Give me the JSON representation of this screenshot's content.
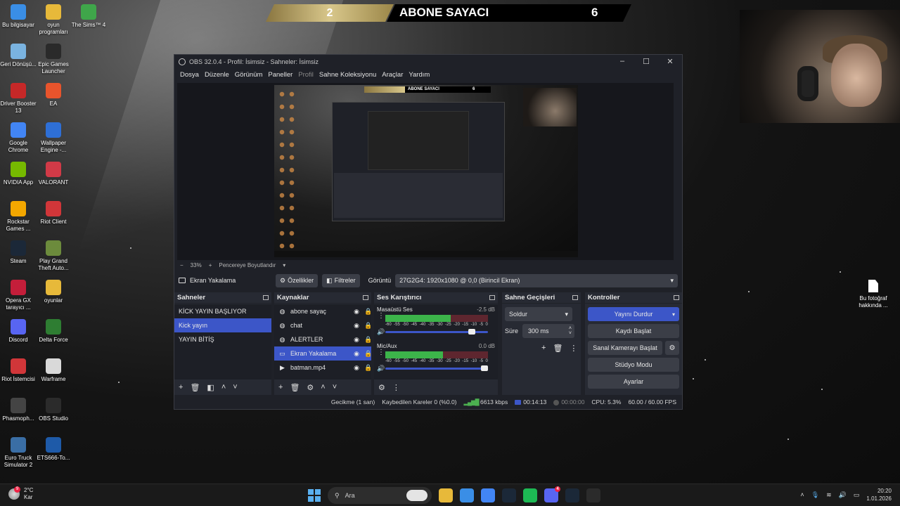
{
  "desktop": {
    "icons_left": [
      {
        "label": "Bu bilgisayar",
        "icon": "computer-icon",
        "color": "#3a8ee6"
      },
      {
        "label": "oyun programları",
        "icon": "folder-icon",
        "color": "#e7b93a"
      },
      {
        "label": "The Sims™ 4",
        "icon": "sims-icon",
        "color": "#3fa64a"
      },
      {
        "label": "Geri Dönüşü...",
        "icon": "recycle-bin-icon",
        "color": "#7ab3e0"
      },
      {
        "label": "Epic Games Launcher",
        "icon": "epic-games-icon",
        "color": "#2a2a2a"
      },
      {
        "label": "Driver Booster 13",
        "icon": "driver-booster-icon",
        "color": "#c62828"
      },
      {
        "label": "EA",
        "icon": "ea-icon",
        "color": "#e8542c"
      },
      {
        "label": "Google Chrome",
        "icon": "chrome-icon",
        "color": "#4285f4"
      },
      {
        "label": "Wallpaper Engine -...",
        "icon": "wallpaper-engine-icon",
        "color": "#2e6fd6"
      },
      {
        "label": "NVIDIA App",
        "icon": "nvidia-icon",
        "color": "#76b900"
      },
      {
        "label": "VALORANT",
        "icon": "valorant-icon",
        "color": "#d13a47"
      },
      {
        "label": "Rockstar Games ...",
        "icon": "rockstar-icon",
        "color": "#f3a700"
      },
      {
        "label": "Riot Client",
        "icon": "riot-client-icon",
        "color": "#d13639"
      },
      {
        "label": "Steam",
        "icon": "steam-icon",
        "color": "#1b2838"
      },
      {
        "label": "Play Grand Theft Auto...",
        "icon": "gta-icon",
        "color": "#6c8b3c"
      },
      {
        "label": "Opera GX tarayıcı ...",
        "icon": "opera-gx-icon",
        "color": "#c41e3a"
      },
      {
        "label": "oyunlar",
        "icon": "folder-icon",
        "color": "#e7b93a"
      },
      {
        "label": "Discord",
        "icon": "discord-icon",
        "color": "#5865f2"
      },
      {
        "label": "Delta Force",
        "icon": "delta-force-icon",
        "color": "#2e7d32"
      },
      {
        "label": "Riot İstemcisi",
        "icon": "riot-client-icon",
        "color": "#d13639"
      },
      {
        "label": "Warframe",
        "icon": "warframe-icon",
        "color": "#d9d9d9"
      },
      {
        "label": "Phasmoph...",
        "icon": "phasmophobia-icon",
        "color": "#444444"
      },
      {
        "label": "OBS Studio",
        "icon": "obs-icon",
        "color": "#2b2b2b"
      },
      {
        "label": "Euro Truck Simulator 2",
        "icon": "ets2-icon",
        "color": "#3a6ea5"
      },
      {
        "label": "ETS666-To...",
        "icon": "ets-icon",
        "color": "#1e5aa8"
      }
    ],
    "file_right": "Bu fotoğraf hakkında ..."
  },
  "counter": {
    "left_value": "2",
    "title": "ABONE SAYACI",
    "right_value": "6"
  },
  "obs": {
    "title": "OBS 32.0.4 - Profil: İsimsiz - Sahneler: İsimsiz",
    "menu": [
      "Dosya",
      "Düzenle",
      "Görünüm",
      "Paneller",
      "Profil",
      "Sahne Koleksiyonu",
      "Araçlar",
      "Yardım"
    ],
    "zoom": {
      "minus": "−",
      "value": "33%",
      "plus": "+",
      "fit": "Pencereye Boyutlandır"
    },
    "context": {
      "source": "Ekran Yakalama",
      "properties": "Özellikler",
      "filters": "Filtreler",
      "display_label": "Görüntü",
      "display_value": "27G2G4: 1920x1080 @ 0,0 (Birincil Ekran)"
    },
    "scenes": {
      "title": "Sahneler",
      "items": [
        "KİCK YAYIN BAŞLIYOR",
        "Kick yayın",
        "YAYIN BİTİŞ"
      ],
      "selected_index": 1
    },
    "sources": {
      "title": "Kaynaklar",
      "items": [
        {
          "name": "abone sayaç",
          "icon": "globe-icon"
        },
        {
          "name": "chat",
          "icon": "globe-icon"
        },
        {
          "name": "ALERTLER",
          "icon": "globe-icon"
        },
        {
          "name": "Ekran Yakalama",
          "icon": "monitor-icon"
        },
        {
          "name": "batman.mp4",
          "icon": "play-icon"
        }
      ],
      "selected_index": 3
    },
    "mixer": {
      "title": "Ses Karıştırıcı",
      "channels": [
        {
          "name": "Masaüstü Ses",
          "db": "-2.5 dB",
          "level_fraction": 0.64,
          "volume_fraction": 0.88
        },
        {
          "name": "Mic/Aux",
          "db": "0.0 dB",
          "level_fraction": 0.56,
          "volume_fraction": 1.0
        }
      ],
      "ticks": [
        "-60",
        "-55",
        "-50",
        "-45",
        "-40",
        "-35",
        "-30",
        "-25",
        "-20",
        "-15",
        "-10",
        "-5",
        "0"
      ]
    },
    "transitions": {
      "title": "Sahne Geçişleri",
      "selected": "Soldur",
      "duration_label": "Süre",
      "duration_value": "300 ms"
    },
    "controls": {
      "title": "Kontroller",
      "stop_stream": "Yayını Durdur",
      "start_recording": "Kaydı Başlat",
      "start_virtual_cam": "Sanal Kamerayı Başlat",
      "studio_mode": "Stüdyo Modu",
      "settings": "Ayarlar"
    },
    "status": {
      "delay": "Gecikme (1 san)",
      "dropped": "Kaybedilen Kareler 0 (%0.0)",
      "bitrate": "6613 kbps",
      "stream_time": "00:14:13",
      "rec_time": "00:00:00",
      "cpu": "CPU: 5.3%",
      "fps": "60.00 / 60.00 FPS"
    }
  },
  "taskbar": {
    "weather_temp": "2°C",
    "weather_desc": "Kar",
    "weather_badge": "9",
    "search_placeholder": "Ara",
    "apps": [
      {
        "icon": "file-explorer-icon",
        "color": "#e7b93a"
      },
      {
        "icon": "monitor-app-icon",
        "color": "#3a8ee6"
      },
      {
        "icon": "chrome-icon",
        "color": "#4285f4"
      },
      {
        "icon": "steam-icon",
        "color": "#1b2838"
      },
      {
        "icon": "spotify-icon",
        "color": "#1db954"
      },
      {
        "icon": "discord-icon",
        "color": "#5865f2",
        "badge": "4"
      },
      {
        "icon": "steam-icon",
        "color": "#1b2838"
      },
      {
        "icon": "obs-icon",
        "color": "#2b2b2b"
      }
    ],
    "time": "20:20",
    "date": "1.01.2026"
  }
}
